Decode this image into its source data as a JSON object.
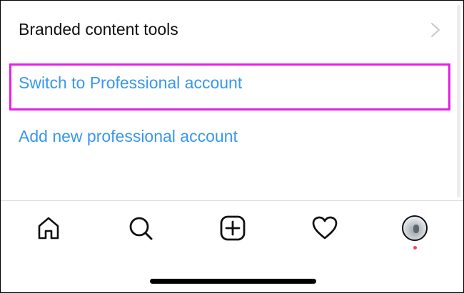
{
  "menu": {
    "branded_content_tools": "Branded content tools",
    "switch_to_professional": "Switch to Professional account",
    "add_new_professional": "Add new professional account"
  },
  "highlight_color": "#e61ee6",
  "link_color": "#3897f0",
  "tabbar": {
    "tabs": [
      {
        "icon": "home-icon"
      },
      {
        "icon": "search-icon"
      },
      {
        "icon": "new-post-icon"
      },
      {
        "icon": "heart-icon"
      },
      {
        "icon": "profile-avatar"
      }
    ],
    "notification_dot_color": "#ed4956"
  }
}
